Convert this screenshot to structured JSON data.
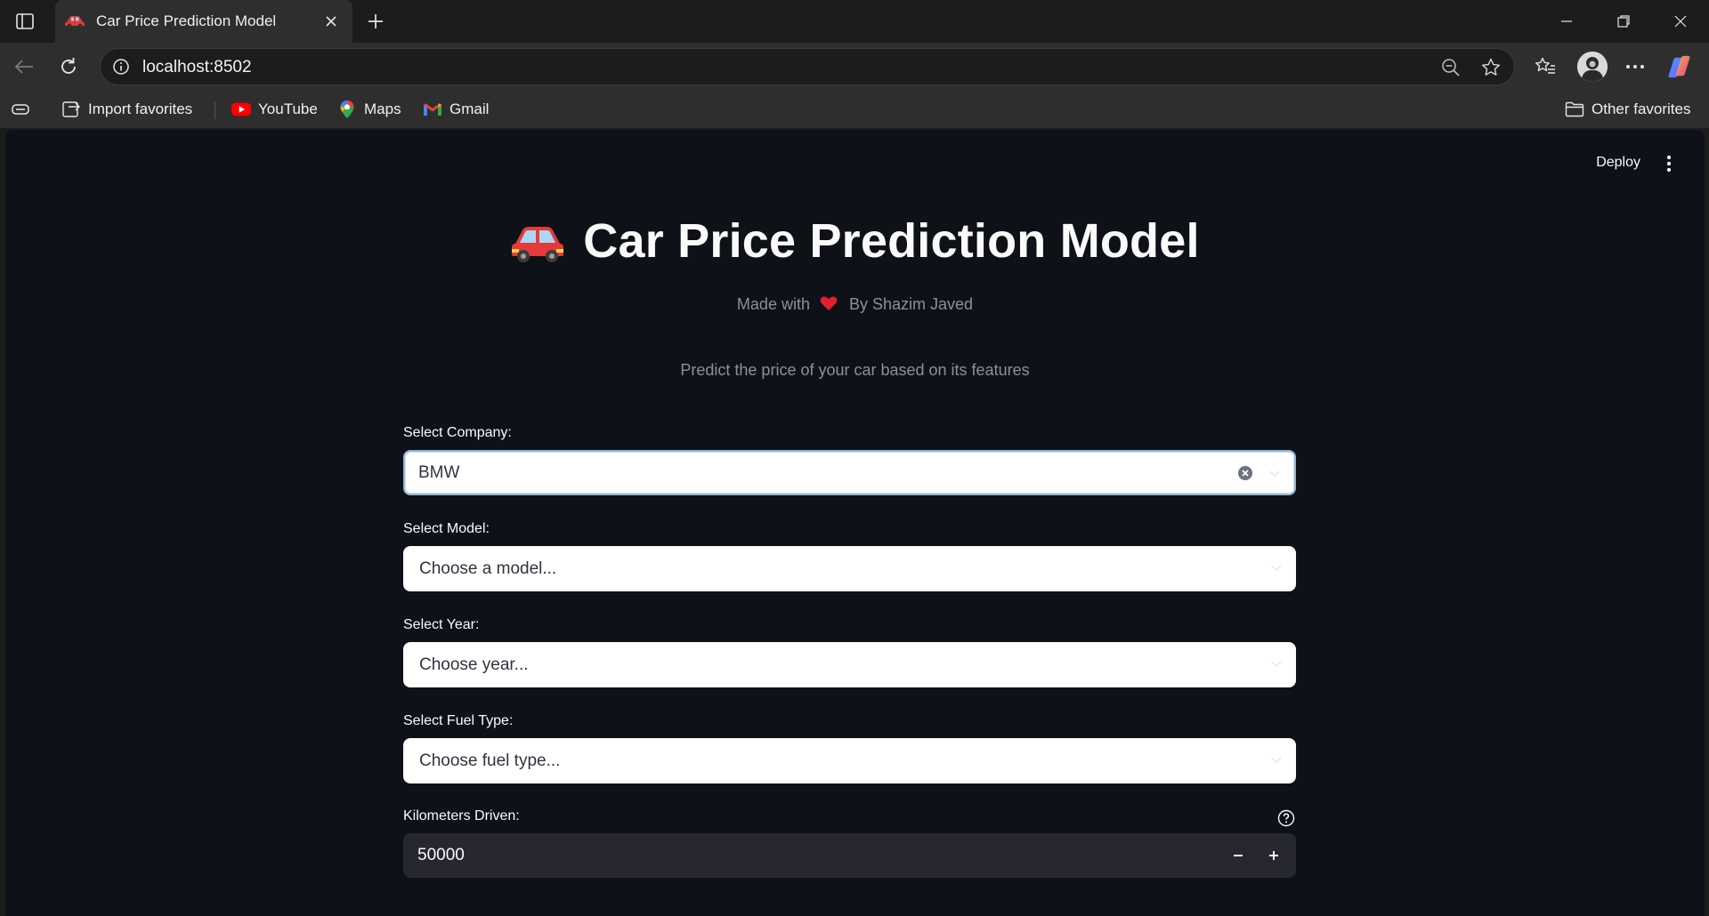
{
  "browser": {
    "tab_title": "Car Price Prediction Model",
    "url": "localhost:8502",
    "bookmarks": [
      {
        "label": "Import favorites",
        "icon": "import-favorites-icon"
      },
      {
        "label": "YouTube",
        "icon": "youtube-icon"
      },
      {
        "label": "Maps",
        "icon": "maps-icon"
      },
      {
        "label": "Gmail",
        "icon": "gmail-icon"
      }
    ],
    "other_favorites": "Other favorites"
  },
  "app": {
    "deploy_label": "Deploy",
    "title": "Car Price Prediction Model",
    "byline_prefix": "Made with",
    "byline_suffix": "By Shazim Javed",
    "tagline": "Predict the price of your car based on its features",
    "fields": {
      "company": {
        "label": "Select Company:",
        "value": "BMW"
      },
      "model": {
        "label": "Select Model:",
        "placeholder": "Choose a model..."
      },
      "year": {
        "label": "Select Year:",
        "placeholder": "Choose year..."
      },
      "fuel": {
        "label": "Select Fuel Type:",
        "placeholder": "Choose fuel type..."
      },
      "km": {
        "label": "Kilometers Driven:",
        "value": "50000"
      }
    }
  },
  "colors": {
    "page_bg": "#0e1117",
    "input_bg": "#ffffff",
    "number_bg": "#262730",
    "accent_heart": "#e0202e",
    "muted_text": "#8d9099"
  }
}
